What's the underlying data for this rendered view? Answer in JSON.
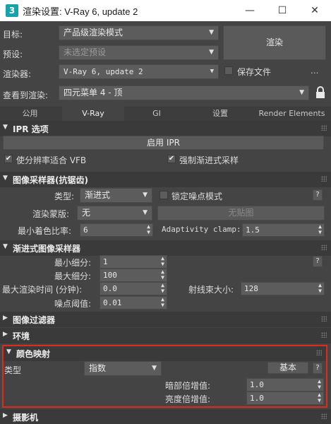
{
  "window": {
    "app_icon": "3",
    "title": "渲染设置: V-Ray 6, update 2",
    "minimize_icon": "—",
    "maximize_icon": "☐",
    "close_icon": "✕"
  },
  "header": {
    "target_label": "目标:",
    "target_value": "产品级渲染模式",
    "preset_label": "预设:",
    "preset_value": "未选定预设",
    "renderer_label": "渲染器:",
    "renderer_value": "V-Ray 6, update 2",
    "save_file_label": "保存文件",
    "ellipsis_label": "...",
    "render_button": "渲染",
    "view_label": "查看到渲染:",
    "view_value": "四元菜单 4 - 顶"
  },
  "tabs": [
    "公用",
    "V-Ray",
    "GI",
    "设置",
    "Render Elements"
  ],
  "active_tab": "V-Ray",
  "ipr": {
    "title": "IPR 选项",
    "enable_button": "启用 IPR",
    "fit_vfb_label": "使分辨率适合 VFB",
    "fit_vfb_checked": true,
    "force_progressive_label": "强制渐进式采样",
    "force_progressive_checked": true
  },
  "image_sampler": {
    "title": "图像采样器(抗锯齿)",
    "type_label": "类型:",
    "type_value": "渐进式",
    "lock_noise_label": "锁定噪点模式",
    "lock_noise_checked": false,
    "help": "?",
    "render_mask_label": "渲染蒙版:",
    "render_mask_value": "无",
    "no_map_button": "无贴图",
    "min_shading_label": "最小着色比率:",
    "min_shading_value": "6",
    "adaptivity_label": "Adaptivity clamp:",
    "adaptivity_value": "1.5"
  },
  "progressive": {
    "title": "渐进式图像采样器",
    "min_subdivs_label": "最小细分:",
    "min_subdivs_value": "1",
    "max_subdivs_label": "最大细分:",
    "max_subdivs_value": "100",
    "max_time_label": "最大渲染时间 (分钟):",
    "max_time_value": "0.0",
    "bundle_size_label": "射线束大小:",
    "bundle_size_value": "128",
    "noise_threshold_label": "噪点阈值:",
    "noise_threshold_value": "0.01",
    "help": "?"
  },
  "image_filter": {
    "title": "图像过滤器"
  },
  "environment": {
    "title": "环境"
  },
  "color_mapping": {
    "title": "颜色映射",
    "type_label": "类型",
    "type_value": "指数",
    "basic_button": "基本",
    "help": "?",
    "dark_mult_label": "暗部倍增值:",
    "dark_mult_value": "1.0",
    "bright_mult_label": "亮度倍增值:",
    "bright_mult_value": "1.0"
  },
  "camera": {
    "title": "摄影机"
  },
  "colors": {
    "highlight_border": "#e02a1b",
    "panel_bg": "#444444",
    "rollout_bg": "#3a3a3a"
  }
}
